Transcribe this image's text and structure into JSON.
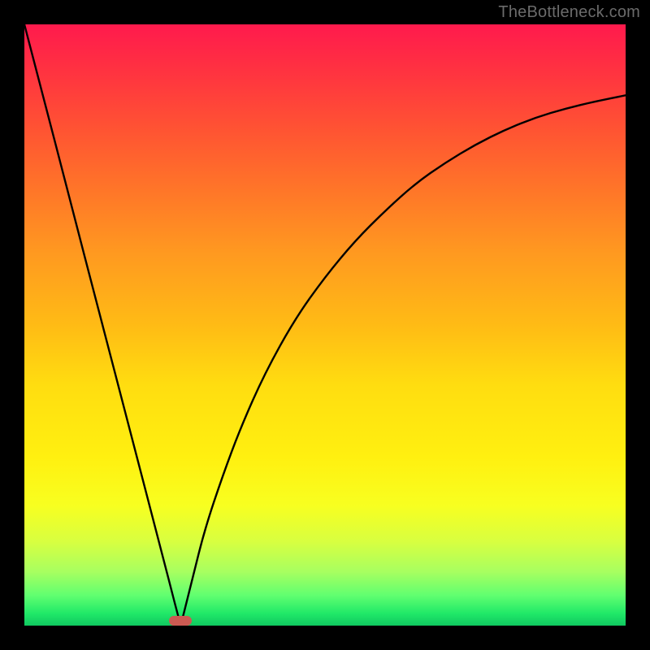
{
  "watermark": "TheBottleneck.com",
  "colors": {
    "background": "#000000",
    "gradient_top": "#ff1a4d",
    "gradient_bottom": "#10c860",
    "curve": "#000000",
    "marker": "#cc5a52"
  },
  "chart_data": {
    "type": "line",
    "title": "",
    "xlabel": "",
    "ylabel": "",
    "xlim": [
      0,
      100
    ],
    "ylim": [
      0,
      100
    ],
    "legend": false,
    "grid": false,
    "annotations": [
      {
        "name": "optimal-marker",
        "x": 26,
        "y": 0.5,
        "shape": "rounded-bar"
      }
    ],
    "series": [
      {
        "name": "left-branch",
        "x": [
          0,
          5,
          10,
          15,
          20,
          24,
          25,
          26
        ],
        "values": [
          100,
          80.8,
          61.5,
          42.3,
          23.1,
          7.7,
          3.8,
          0
        ]
      },
      {
        "name": "right-branch",
        "x": [
          26,
          28,
          30,
          33,
          36,
          40,
          45,
          50,
          55,
          60,
          65,
          70,
          75,
          80,
          85,
          90,
          95,
          100
        ],
        "values": [
          0,
          8,
          16,
          25,
          33,
          42,
          51,
          58,
          64,
          69,
          73.5,
          77,
          80,
          82.5,
          84.5,
          86,
          87.2,
          88.2
        ]
      }
    ]
  }
}
